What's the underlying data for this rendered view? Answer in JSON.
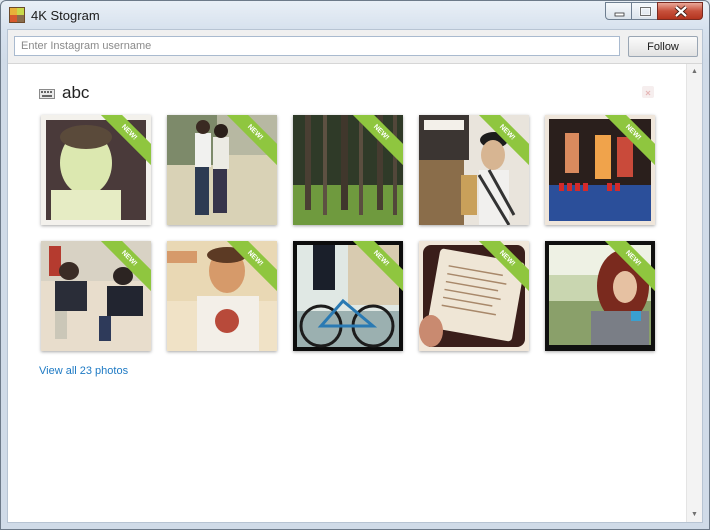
{
  "window": {
    "title": "4K Stogram"
  },
  "toolbar": {
    "search_placeholder": "Enter Instagram username",
    "search_value": "",
    "follow_label": "Follow"
  },
  "section": {
    "title": "abc",
    "view_all_label": "View all 23 photos"
  },
  "photos": [
    {
      "name": "photo-portrait-boy",
      "badge": "NEW!"
    },
    {
      "name": "photo-couple-walking",
      "badge": "NEW!"
    },
    {
      "name": "photo-forest",
      "badge": "NEW!"
    },
    {
      "name": "photo-boy-cap-shop",
      "badge": "NEW!"
    },
    {
      "name": "photo-party-cups",
      "badge": "NEW!"
    },
    {
      "name": "photo-two-boys-sitting",
      "badge": "NEW!"
    },
    {
      "name": "photo-boy-shirt",
      "badge": "NEW!"
    },
    {
      "name": "photo-bicycle",
      "badge": "NEW!"
    },
    {
      "name": "photo-book-pages",
      "badge": "NEW!"
    },
    {
      "name": "photo-girl-field",
      "badge": "NEW!"
    }
  ],
  "colors": {
    "link": "#1e7ac4",
    "badge": "#8fc63f",
    "close": "#c7513c"
  },
  "icons": [
    "app-icon",
    "minimize-icon",
    "maximize-icon",
    "close-icon",
    "keyboard-icon",
    "remove-icon"
  ]
}
